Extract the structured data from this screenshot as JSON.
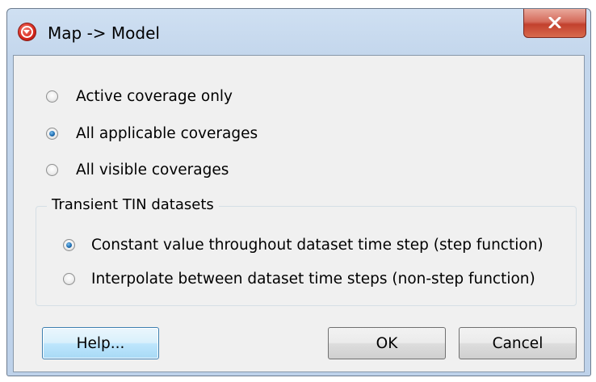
{
  "window": {
    "title": "Map -> Model",
    "close_glyph": "x"
  },
  "options": [
    {
      "label": "Active coverage only",
      "checked": false
    },
    {
      "label": "All applicable coverages",
      "checked": true
    },
    {
      "label": "All visible coverages",
      "checked": false
    }
  ],
  "transient_group": {
    "title": "Transient TIN datasets",
    "options": [
      {
        "label": "Constant value throughout dataset time step (step function)",
        "checked": true
      },
      {
        "label": "Interpolate between dataset time steps (non-step function)",
        "checked": false
      }
    ]
  },
  "buttons": {
    "help": "Help...",
    "ok": "OK",
    "cancel": "Cancel"
  },
  "colors": {
    "frame": "#c3d6ec",
    "client_background": "#f0f0f0",
    "close_button": "#c2412e",
    "radio_selected": "#1f6fb4"
  }
}
